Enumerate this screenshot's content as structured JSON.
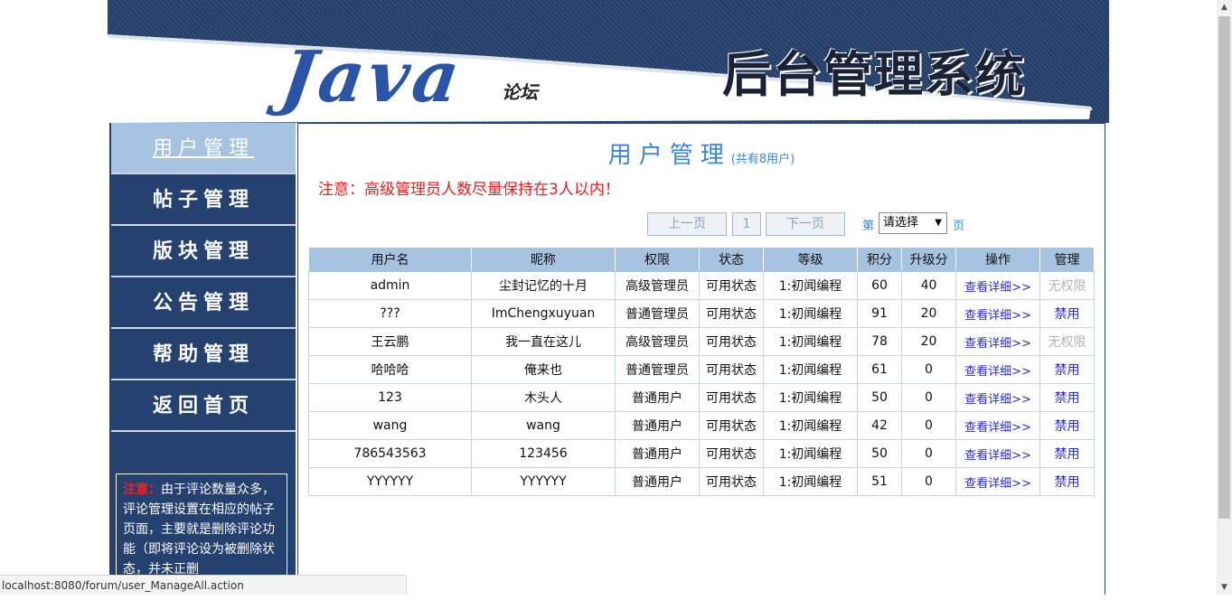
{
  "banner": {
    "logo_text": "Java",
    "logo_sub": "论坛",
    "system_title": "后台管理系统"
  },
  "sidebar": {
    "items": [
      {
        "label": "用户管理",
        "active": true
      },
      {
        "label": "帖子管理"
      },
      {
        "label": "版块管理"
      },
      {
        "label": "公告管理"
      },
      {
        "label": "帮助管理"
      },
      {
        "label": "返回首页"
      }
    ],
    "notice_label": "注意：",
    "notice_text": "由于评论数量众多，评论管理设置在相应的帖子页面，主要就是删除评论功能（即将评论设为被删除状态，并未正删"
  },
  "main": {
    "title": "用户管理",
    "title_count": "(共有8用户)",
    "warning": "注意：高级管理员人数尽量保持在3人以内！",
    "pager": {
      "prev": "上一页",
      "current": "1",
      "next": "下一页",
      "label_pre": "第",
      "select_value": "请选择",
      "label_post": "页"
    },
    "columns": [
      "用户名",
      "昵称",
      "权限",
      "状态",
      "等级",
      "积分",
      "升级分",
      "操作",
      "管理"
    ],
    "rows": [
      [
        "admin",
        "尘封记忆的十月",
        "高级管理员",
        "可用状态",
        "1:初闻编程",
        "60",
        "40",
        "查看详细>>",
        "无权限"
      ],
      [
        "???",
        "ImChengxuyuan",
        "普通管理员",
        "可用状态",
        "1:初闻编程",
        "91",
        "20",
        "查看详细>>",
        "禁用"
      ],
      [
        "王云鹏",
        "我一直在这儿",
        "高级管理员",
        "可用状态",
        "1:初闻编程",
        "78",
        "20",
        "查看详细>>",
        "无权限"
      ],
      [
        "哈哈哈",
        "俺来也",
        "普通管理员",
        "可用状态",
        "1:初闻编程",
        "61",
        "0",
        "查看详细>>",
        "禁用"
      ],
      [
        "123",
        "木头人",
        "普通用户",
        "可用状态",
        "1:初闻编程",
        "50",
        "0",
        "查看详细>>",
        "禁用"
      ],
      [
        "wang",
        "wang",
        "普通用户",
        "可用状态",
        "1:初闻编程",
        "42",
        "0",
        "查看详细>>",
        "禁用"
      ],
      [
        "786543563",
        "123456",
        "普通用户",
        "可用状态",
        "1:初闻编程",
        "50",
        "0",
        "查看详细>>",
        "禁用"
      ],
      [
        "YYYYYY",
        "YYYYYY",
        "普通用户",
        "可用状态",
        "1:初闻编程",
        "51",
        "0",
        "查看详细>>",
        "禁用"
      ]
    ]
  },
  "status_bar": {
    "url": "localhost:8080/forum/user_ManageAll.action"
  },
  "colors": {
    "nav_bg": "#24416f",
    "nav_active": "#a6c3e2",
    "title_blue": "#3c86d2",
    "warning_red": "#e52222",
    "link_blue": "#2a2cc8"
  }
}
